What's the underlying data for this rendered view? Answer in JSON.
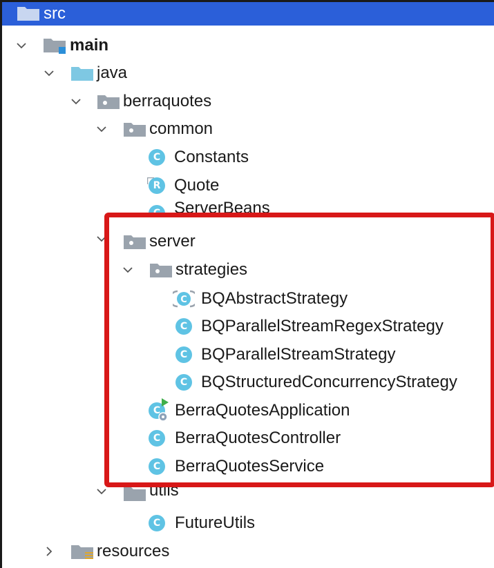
{
  "tree": {
    "src": "src",
    "main": "main",
    "java": "java",
    "berraquotes": "berraquotes",
    "common": "common",
    "constants": "Constants",
    "quote": "Quote",
    "server_beans": "ServerBeans",
    "server": "server",
    "strategies": "strategies",
    "bq_abstract_strategy": "BQAbstractStrategy",
    "bq_parallel_stream_regex_strategy": "BQParallelStreamRegexStrategy",
    "bq_parallel_stream_strategy": "BQParallelStreamStrategy",
    "bq_structured_concurrency_strategy": "BQStructuredConcurrencyStrategy",
    "berra_quotes_application": "BerraQuotesApplication",
    "berra_quotes_controller": "BerraQuotesController",
    "berra_quotes_service": "BerraQuotesService",
    "utils": "utils",
    "future_utils": "FutureUtils",
    "resources": "resources"
  },
  "badges": {
    "class": "C",
    "record": "R"
  },
  "colors": {
    "selection": "#2b5fd9",
    "highlight_box": "#d81818",
    "class_badge": "#5fc3e4",
    "folder": "#9aa3ad",
    "source_folder": "#7ec8e3"
  }
}
